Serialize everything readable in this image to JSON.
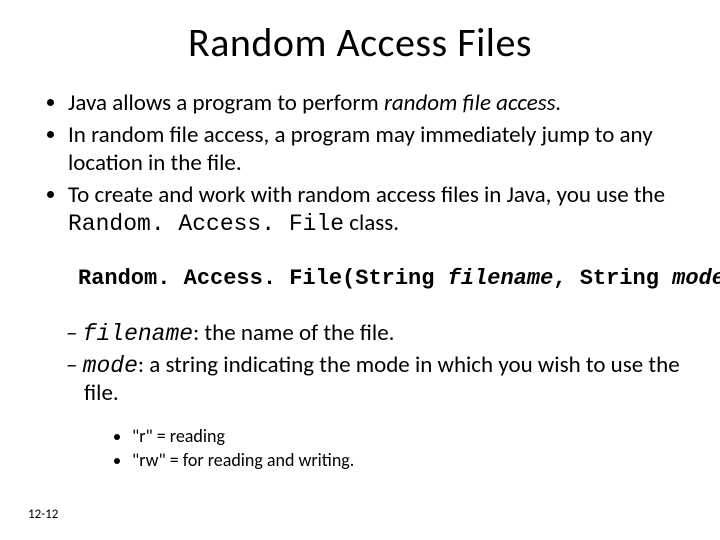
{
  "title": "Random Access Files",
  "bullets": {
    "b1_pre": "Java allows a program to perform ",
    "b1_em": "random file access.",
    "b2": "In random file access, a program may immediately jump to any location in the file.",
    "b3_pre": "To create and work with random access files in Java, you use the ",
    "b3_code": "Random. Access. File",
    "b3_post": " class."
  },
  "signature": {
    "cls": "Random. Access. File(",
    "arg1": "String",
    "argname1": "filename",
    "sep": ", ",
    "arg2": "String",
    "argname2": "mode",
    "close": ")"
  },
  "params": {
    "p1_code": "filename",
    "p1_text": ": the name of the file.",
    "p2_code": "mode",
    "p2_text": ": a string indicating the mode in which you wish to use the file."
  },
  "modes": {
    "m1": "\"r\"   = reading",
    "m2": "\"rw\" = for reading and writing."
  },
  "pagenum": "12-12"
}
